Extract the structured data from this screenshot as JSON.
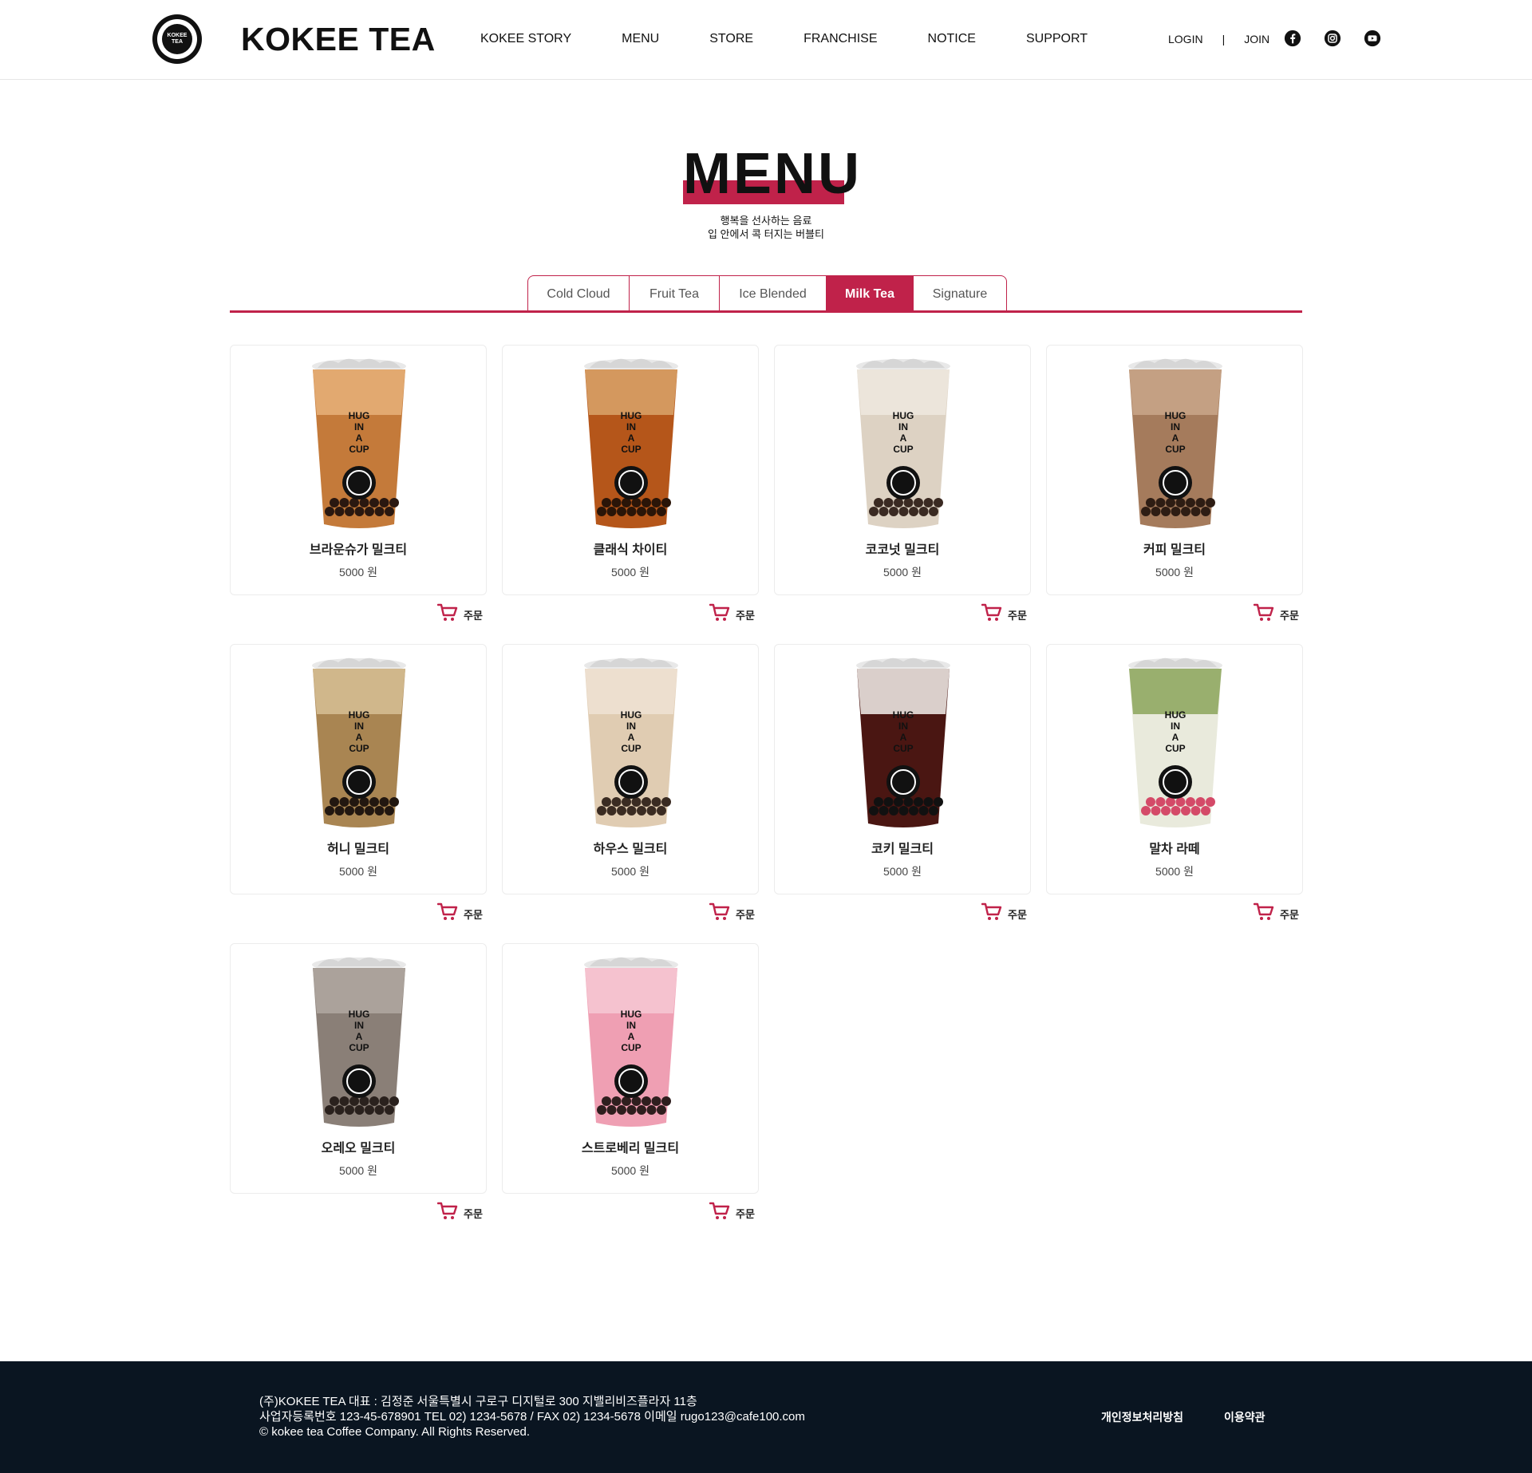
{
  "header": {
    "logo_text": "KOKEE TEA",
    "brand": "KOKEE TEA",
    "nav": [
      "KOKEE STORY",
      "MENU",
      "STORE",
      "FRANCHISE",
      "NOTICE",
      "SUPPORT"
    ],
    "login": "LOGIN",
    "separator": "|",
    "join": "JOIN",
    "social": [
      "facebook-icon",
      "instagram-icon",
      "youtube-icon"
    ]
  },
  "page": {
    "title": "MENU",
    "subtitle_line1": "행복을 선사하는 음료",
    "subtitle_line2": "입 안에서 콕 터지는 버블티"
  },
  "tabs": [
    {
      "label": "Cold Cloud",
      "active": false
    },
    {
      "label": "Fruit Tea",
      "active": false
    },
    {
      "label": "Ice Blended",
      "active": false
    },
    {
      "label": "Milk Tea",
      "active": true
    },
    {
      "label": "Signature",
      "active": false
    }
  ],
  "cup_label": [
    "HUG",
    "IN",
    "A",
    "CUP"
  ],
  "order_label": "주문",
  "products": [
    {
      "name": "브라운슈가 밀크티",
      "price": "5000 원",
      "drink_color": "#c47a3a",
      "top_color": "#e7b27a",
      "pearl_color": "#2a1810"
    },
    {
      "name": "클래식 차이티",
      "price": "5000 원",
      "drink_color": "#b5561a",
      "top_color": "#d9a36b",
      "pearl_color": "#2a1508"
    },
    {
      "name": "코코넛 밀크티",
      "price": "5000 원",
      "drink_color": "#ddd2c3",
      "top_color": "#efe9df",
      "pearl_color": "#3a2a22"
    },
    {
      "name": "커피 밀크티",
      "price": "5000 원",
      "drink_color": "#a57b5c",
      "top_color": "#c9a789",
      "pearl_color": "#2e1d14"
    },
    {
      "name": "허니 밀크티",
      "price": "5000 원",
      "drink_color": "#a98552",
      "top_color": "#d7bf95",
      "pearl_color": "#221710"
    },
    {
      "name": "하우스 밀크티",
      "price": "5000 원",
      "drink_color": "#e0ccb2",
      "top_color": "#eee2d3",
      "pearl_color": "#3a2b22"
    },
    {
      "name": "코키 밀크티",
      "price": "5000 원",
      "drink_color": "#4a1612",
      "top_color": "#f3f0ec",
      "pearl_color": "#111111"
    },
    {
      "name": "말차 라떼",
      "price": "5000 원",
      "drink_color": "#e9eadc",
      "top_color": "#8ba55b",
      "pearl_color": "#d44a68"
    },
    {
      "name": "오레오 밀크티",
      "price": "5000 원",
      "drink_color": "#8a7f77",
      "top_color": "#b0a8a1",
      "pearl_color": "#2a211d"
    },
    {
      "name": "스트로베리 밀크티",
      "price": "5000 원",
      "drink_color": "#ef9fb3",
      "top_color": "#f6c8d3",
      "pearl_color": "#2e1e1e"
    }
  ],
  "footer": {
    "line1": "(주)KOKEE TEA 대표 : 김정준 서울특별시 구로구 디지털로 300 지밸리비즈플라자 11층",
    "line2": "사업자등록번호 123-45-678901 TEL 02) 1234-5678 / FAX 02) 1234-5678 이메일 rugo123@cafe100.com",
    "line3": "© kokee tea Coffee Company. All Rights Reserved.",
    "links": [
      "개인정보처리방침",
      "이용약관"
    ]
  },
  "colors": {
    "accent": "#c0224a",
    "footer_bg": "#0a1521"
  }
}
